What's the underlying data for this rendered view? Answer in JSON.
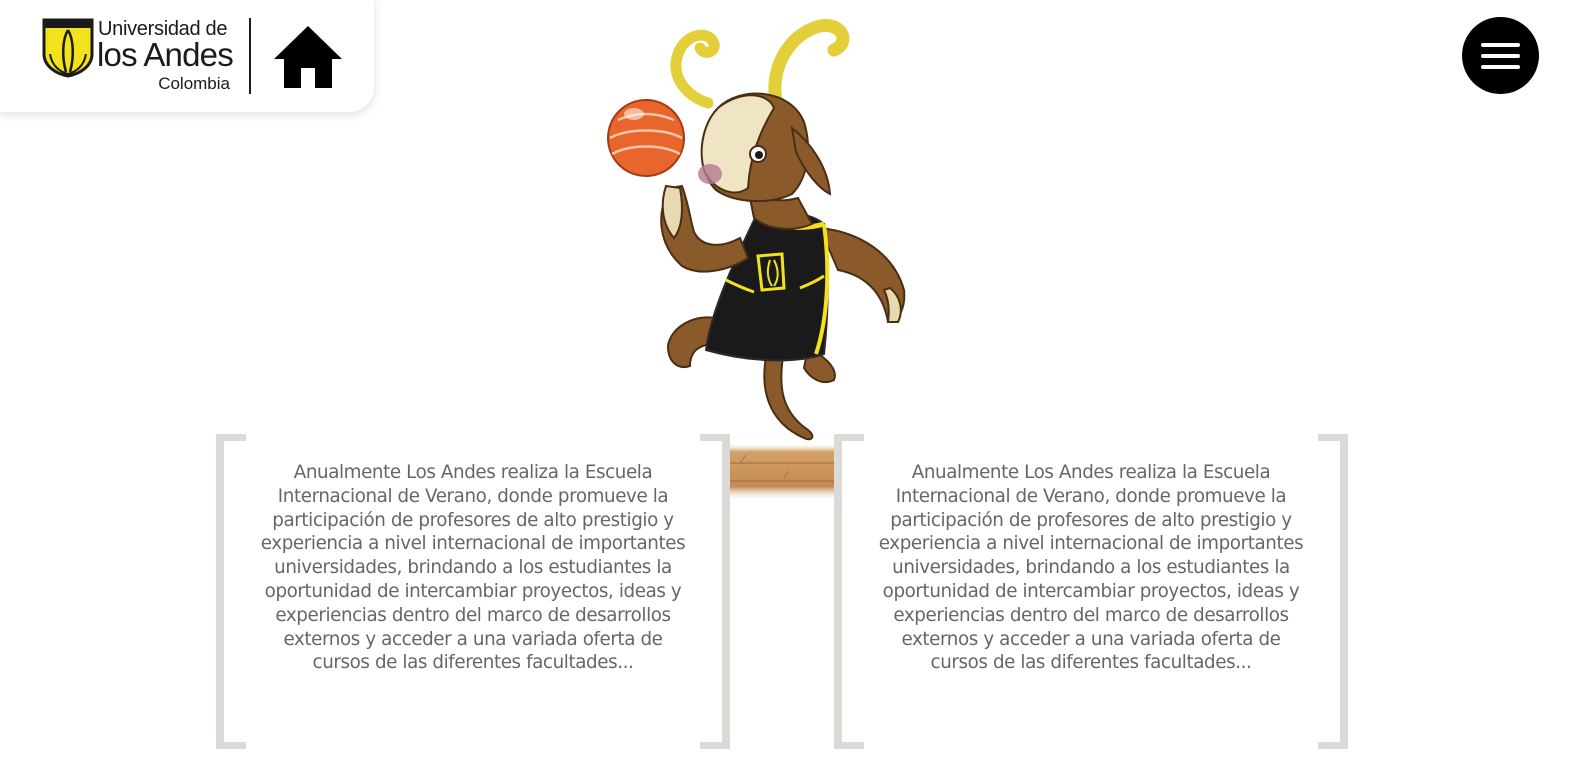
{
  "header": {
    "logo": {
      "line1": "Universidad de",
      "line2": "los Andes",
      "line3": "Colombia",
      "icon": "university-shield-icon"
    },
    "home_icon": "home-icon"
  },
  "menu": {
    "icon": "hamburger-menu-icon"
  },
  "mascot": {
    "icon": "goat-mascot-basketball"
  },
  "cards": [
    {
      "text": "Anualmente Los Andes realiza la Escuela Internacional de Verano, donde promueve la participación de profesores de alto prestigio y experiencia a nivel internacional de importantes universidades, brindando a los estudiantes la oportunidad de intercambiar proyectos, ideas y experiencias dentro del marco de desarrollos externos y acceder a una variada oferta de cursos de las diferentes facultades..."
    },
    {
      "text": "Anualmente Los Andes realiza la Escuela Internacional de Verano, donde promueve la participación de profesores de alto prestigio y experiencia a nivel internacional de importantes universidades, brindando a los estudiantes la oportunidad de intercambiar proyectos, ideas y experiencias dentro del marco de desarrollos externos y acceder a una variada oferta de cursos de las diferentes facultades..."
    }
  ],
  "colors": {
    "brand_yellow": "#f2e21c",
    "text_gray": "#666666",
    "bracket_gray": "#dcdad7",
    "jersey_black": "#1a1a1a",
    "goat_brown": "#8b5a2b"
  }
}
